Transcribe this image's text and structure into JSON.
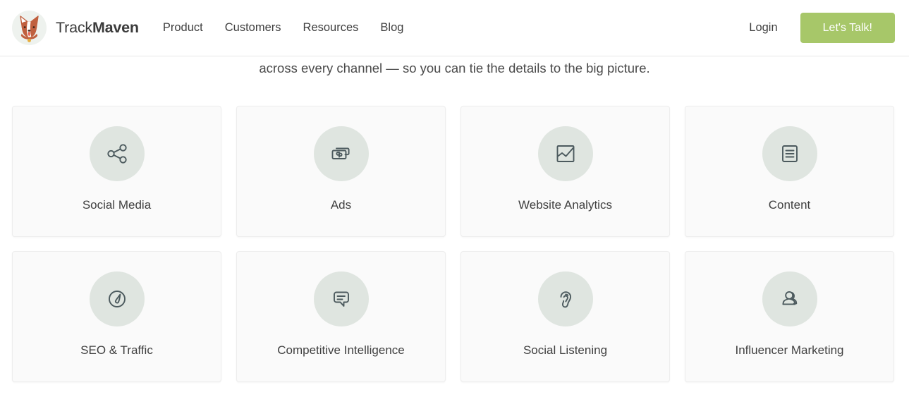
{
  "header": {
    "brand": {
      "logo_icon": "corgi-mascot-logo",
      "name_light": "Track",
      "name_bold": "Maven"
    },
    "nav": [
      {
        "label": "Product"
      },
      {
        "label": "Customers"
      },
      {
        "label": "Resources"
      },
      {
        "label": "Blog"
      }
    ],
    "login_label": "Login",
    "cta_label": "Let's Talk!",
    "cta_color": "#a7c769"
  },
  "intro": {
    "text": "across every channel — so you can tie the details to the big picture."
  },
  "cards": [
    {
      "label": "Social Media",
      "icon": "share-network-icon"
    },
    {
      "label": "Ads",
      "icon": "money-cards-icon"
    },
    {
      "label": "Website Analytics",
      "icon": "line-chart-frame-icon"
    },
    {
      "label": "Content",
      "icon": "document-lines-icon"
    },
    {
      "label": "SEO & Traffic",
      "icon": "speedometer-gauge-icon"
    },
    {
      "label": "Competitive Intelligence",
      "icon": "speech-bubble-icon"
    },
    {
      "label": "Social Listening",
      "icon": "ear-icon"
    },
    {
      "label": "Influencer Marketing",
      "icon": "two-people-icon"
    }
  ],
  "theme": {
    "icon_circle_color": "#dfe5e0",
    "icon_stroke_color": "#4c5a5e",
    "card_background": "#fafafa",
    "page_background": "#ffffff"
  }
}
